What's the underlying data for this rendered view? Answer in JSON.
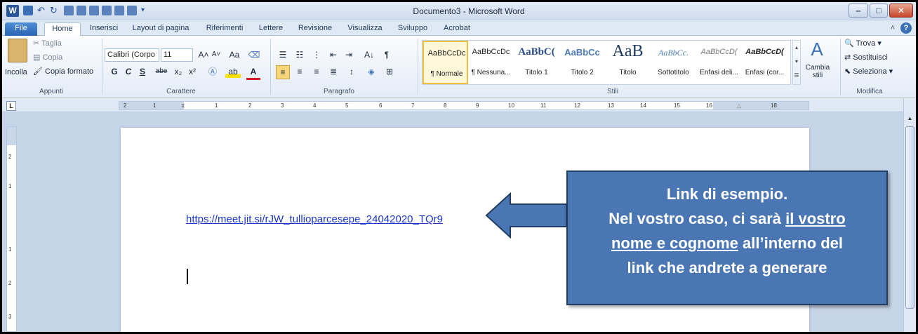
{
  "titlebar": {
    "title": "Documento3 - Microsoft Word",
    "app_logo": "W"
  },
  "tabs": [
    "File",
    "Home",
    "Inserisci",
    "Layout di pagina",
    "Riferimenti",
    "Lettere",
    "Revisione",
    "Visualizza",
    "Sviluppo",
    "Acrobat"
  ],
  "ribbon": {
    "appunti": {
      "paste_label": "Incolla",
      "cut_label": "Taglia",
      "copy_label": "Copia",
      "format_painter_label": "Copia formato",
      "group_label": "Appunti"
    },
    "carattere": {
      "font_name": "Calibri (Corpo",
      "font_size": "11",
      "group_label": "Carattere",
      "bold": "G",
      "italic": "C",
      "underline": "S",
      "strike": "abe",
      "subscript": "x₂",
      "superscript": "x²",
      "grow": "A˄",
      "shrink": "A˅",
      "case": "Aa",
      "font_color_letter": "A"
    },
    "paragrafo": {
      "group_label": "Paragrafo",
      "sort": "A↓",
      "pilcrow": "¶"
    },
    "stili": {
      "group_label": "Stili",
      "styles": [
        {
          "sample": "AaBbCcDc",
          "name": "¶ Normale"
        },
        {
          "sample": "AaBbCcDc",
          "name": "¶ Nessuna..."
        },
        {
          "sample": "AaBbC(",
          "name": "Titolo 1"
        },
        {
          "sample": "AaBbCc",
          "name": "Titolo 2"
        },
        {
          "sample": "AaB",
          "name": "Titolo"
        },
        {
          "sample": "AaBbCc.",
          "name": "Sottotitolo"
        },
        {
          "sample": "AaBbCcD(",
          "name": "Enfasi deli..."
        },
        {
          "sample": "AaBbCcD(",
          "name": "Enfasi (cor..."
        }
      ],
      "change_styles": "Cambia stili"
    },
    "modifica": {
      "group_label": "Modifica",
      "find": "Trova",
      "replace": "Sostituisci",
      "select": "Seleziona"
    }
  },
  "ruler": {
    "tab_selector": "L",
    "numbers": [
      "2",
      "1",
      "1",
      "2",
      "3",
      "4",
      "5",
      "6",
      "7",
      "8",
      "9",
      "10",
      "11",
      "12",
      "13",
      "14",
      "15",
      "16",
      "18"
    ],
    "vertical_numbers": [
      "2",
      "1",
      "1",
      "2",
      "3"
    ]
  },
  "document": {
    "link": "https://meet.jit.si/rJW_tullioparcesepe_24042020_TQr9"
  },
  "callout": {
    "line1": "Link di esempio.",
    "line2_pre": "Nel vostro caso, ci sarà ",
    "line2_u": "il vostro",
    "line3_u": "nome e cognome",
    "line3_post": " all’interno del",
    "line4": "link che andrete a generare"
  },
  "colors": {
    "callout_fill": "#4a76b3",
    "callout_border": "#213d64",
    "link": "#1a37c8",
    "workspace": "#c6d4e8"
  }
}
